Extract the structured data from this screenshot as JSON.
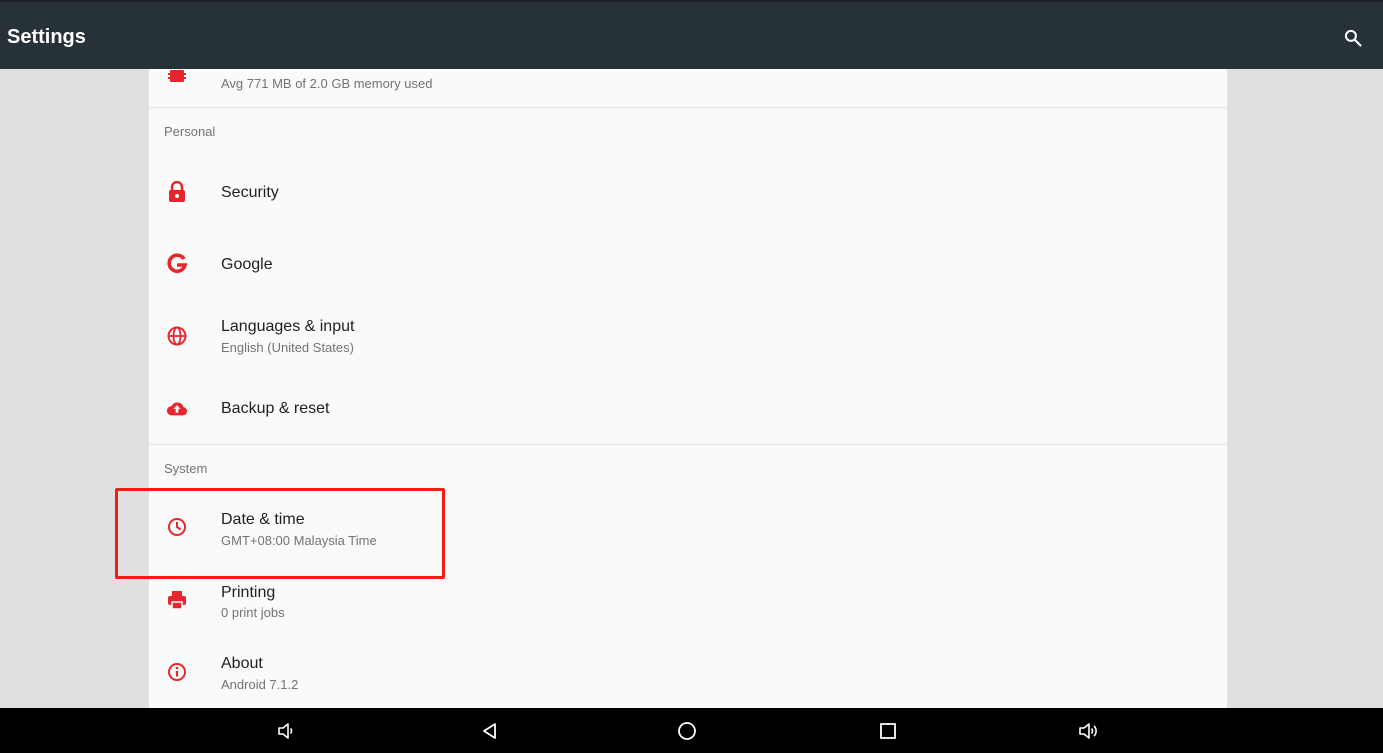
{
  "app": {
    "title": "Settings"
  },
  "colors": {
    "accent": "#e8262e",
    "toolbar": "#263238",
    "highlight": "#f21d13"
  },
  "memory": {
    "summary": "Avg 771 MB of 2.0 GB memory used",
    "icon": "memory-icon"
  },
  "sections": [
    {
      "header": "Personal",
      "items": [
        {
          "label": "Security",
          "sub": "",
          "icon": "lock-icon"
        },
        {
          "label": "Google",
          "sub": "",
          "icon": "google-icon"
        },
        {
          "label": "Languages & input",
          "sub": "English (United States)",
          "icon": "globe-icon"
        },
        {
          "label": "Backup & reset",
          "sub": "",
          "icon": "cloud-upload-icon"
        }
      ]
    },
    {
      "header": "System",
      "items": [
        {
          "label": "Date & time",
          "sub": "GMT+08:00 Malaysia Time",
          "icon": "clock-icon"
        },
        {
          "label": "Printing",
          "sub": "0 print jobs",
          "icon": "printer-icon"
        },
        {
          "label": "About",
          "sub": "Android 7.1.2",
          "icon": "info-icon"
        }
      ]
    }
  ],
  "navbar": [
    "volume-down-icon",
    "back-icon",
    "home-icon",
    "recents-icon",
    "volume-up-icon"
  ]
}
